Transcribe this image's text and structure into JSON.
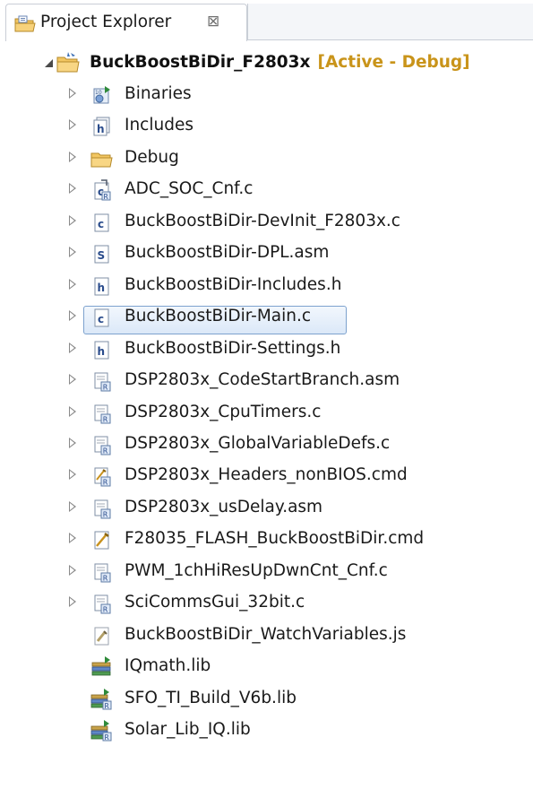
{
  "view": {
    "title": "Project Explorer",
    "close_glyph": "⊠"
  },
  "project": {
    "name": "BuckBoostBiDir_F2803x",
    "config": "[Active - Debug]"
  },
  "tree": [
    {
      "label": "Binaries",
      "icon": "binaries-icon",
      "expandable": true
    },
    {
      "label": "Includes",
      "icon": "includes-icon",
      "expandable": true
    },
    {
      "label": "Debug",
      "icon": "folder-icon",
      "expandable": true
    },
    {
      "label": "ADC_SOC_Cnf.c",
      "icon": "c-linked-source-icon",
      "expandable": true
    },
    {
      "label": "BuckBoostBiDir-DevInit_F2803x.c",
      "icon": "c-source-icon",
      "expandable": true
    },
    {
      "label": "BuckBoostBiDir-DPL.asm",
      "icon": "asm-source-icon",
      "expandable": true
    },
    {
      "label": "BuckBoostBiDir-Includes.h",
      "icon": "header-file-icon",
      "expandable": true
    },
    {
      "label": "BuckBoostBiDir-Main.c",
      "icon": "c-source-icon",
      "expandable": true,
      "selected": true
    },
    {
      "label": "BuckBoostBiDir-Settings.h",
      "icon": "header-file-icon",
      "expandable": true
    },
    {
      "label": "DSP2803x_CodeStartBranch.asm",
      "icon": "linked-file-icon",
      "expandable": true
    },
    {
      "label": "DSP2803x_CpuTimers.c",
      "icon": "linked-file-icon",
      "expandable": true
    },
    {
      "label": "DSP2803x_GlobalVariableDefs.c",
      "icon": "linked-file-icon",
      "expandable": true
    },
    {
      "label": "DSP2803x_Headers_nonBIOS.cmd",
      "icon": "linked-cmd-icon",
      "expandable": true
    },
    {
      "label": "DSP2803x_usDelay.asm",
      "icon": "linked-file-icon",
      "expandable": true
    },
    {
      "label": "F28035_FLASH_BuckBoostBiDir.cmd",
      "icon": "cmd-file-icon",
      "expandable": true
    },
    {
      "label": "PWM_1chHiResUpDwnCnt_Cnf.c",
      "icon": "linked-file-icon",
      "expandable": true
    },
    {
      "label": "SciCommsGui_32bit.c",
      "icon": "linked-file-icon",
      "expandable": true
    },
    {
      "label": "BuckBoostBiDir_WatchVariables.js",
      "icon": "script-file-icon",
      "expandable": false
    },
    {
      "label": "IQmath.lib",
      "icon": "library-icon",
      "expandable": false
    },
    {
      "label": "SFO_TI_Build_V6b.lib",
      "icon": "linked-library-icon",
      "expandable": false
    },
    {
      "label": "Solar_Lib_IQ.lib",
      "icon": "linked-library-icon",
      "expandable": false
    }
  ]
}
